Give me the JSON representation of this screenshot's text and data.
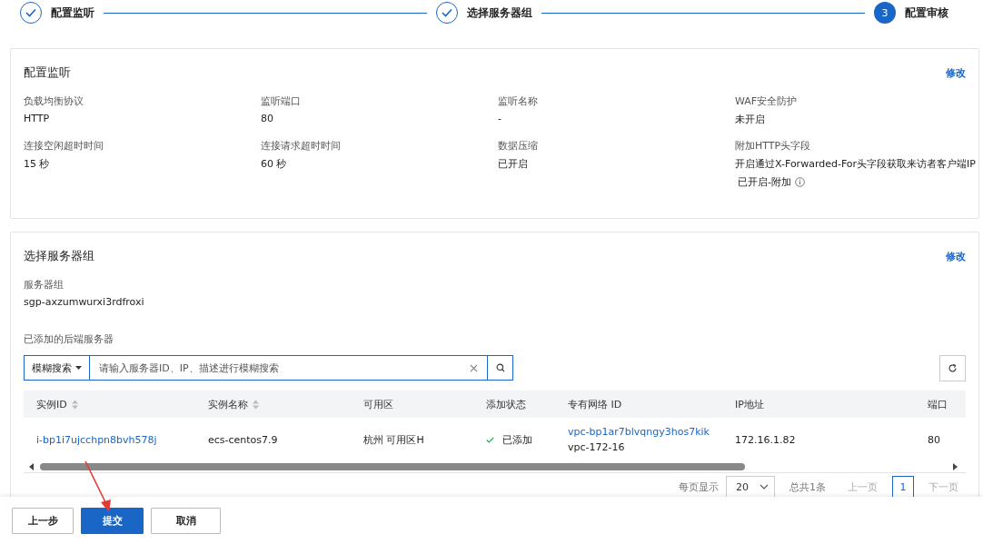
{
  "steps": [
    {
      "label": "配置监听",
      "done": true
    },
    {
      "label": "选择服务器组",
      "done": true
    },
    {
      "label": "配置审核",
      "done": false,
      "number": "3"
    }
  ],
  "listener_card": {
    "title": "配置监听",
    "edit": "修改",
    "fields": [
      {
        "label": "负载均衡协议",
        "value": "HTTP"
      },
      {
        "label": "监听端口",
        "value": "80"
      },
      {
        "label": "监听名称",
        "value": "-"
      },
      {
        "label": "WAF安全防护",
        "value": "未开启"
      },
      {
        "label": "连接空闲超时时间",
        "value": "15 秒"
      },
      {
        "label": "连接请求超时时间",
        "value": "60 秒"
      },
      {
        "label": "数据压缩",
        "value": "已开启"
      },
      {
        "label": "附加HTTP头字段",
        "value": "开启通过X-Forwarded-For头字段获取来访者客户端IP",
        "extra": "已开启-附加"
      }
    ]
  },
  "server_group_card": {
    "title": "选择服务器组",
    "edit": "修改",
    "group_label": "服务器组",
    "group_value": "sgp-axzumwurxi3rdfroxi",
    "servers_label": "已添加的后端服务器",
    "search": {
      "mode": "模糊搜索",
      "placeholder": "请输入服务器ID、IP、描述进行模糊搜索"
    },
    "table": {
      "columns": [
        {
          "label": "实例ID",
          "sortable": true
        },
        {
          "label": "实例名称",
          "sortable": true
        },
        {
          "label": "可用区",
          "sortable": false
        },
        {
          "label": "添加状态",
          "sortable": false
        },
        {
          "label": "专有网络 ID",
          "sortable": false
        },
        {
          "label": "IP地址",
          "sortable": false
        },
        {
          "label": "端口",
          "sortable": false
        }
      ],
      "rows": [
        {
          "instance_id": "i-bp1i7ujcchpn8bvh578j",
          "name": "ecs-centos7.9",
          "zone": "杭州 可用区H",
          "status": "已添加",
          "added": true,
          "vpc_id": "vpc-bp1ar7blvqngy3hos7kik",
          "vpc_name": "vpc-172-16",
          "ip": "172.16.1.82",
          "port": "80"
        }
      ]
    },
    "pagination": {
      "per_page_label": "每页显示",
      "per_page": "20",
      "total": "总共1条",
      "prev": "上一页",
      "page": "1",
      "next": "下一页"
    }
  },
  "footer": {
    "buttons": [
      {
        "label": "上一步",
        "kind": "default"
      },
      {
        "label": "提交",
        "kind": "primary"
      },
      {
        "label": "取消",
        "kind": "default"
      }
    ]
  }
}
